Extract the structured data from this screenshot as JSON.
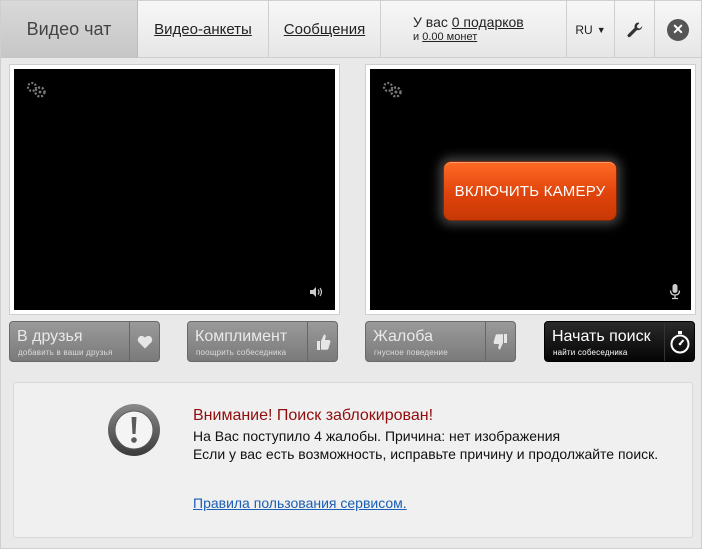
{
  "nav": {
    "active_tab": "Видео чат",
    "tab_profiles": "Видео-анкеты",
    "tab_messages": "Сообщения",
    "gifts_prefix": "У вас",
    "gifts_link": "0 подарков",
    "coins_prefix": "и",
    "coins_link": "0.00 монет",
    "language": "RU",
    "icons": {
      "settings": "wrench-icon",
      "close": "close-icon",
      "lang_caret": "chevron-down-icon"
    }
  },
  "video": {
    "left_icons": [
      "gear-icon",
      "speaker-icon"
    ],
    "right_icons": [
      "gear-icon",
      "microphone-icon"
    ],
    "camera_button": "ВКЛЮЧИТЬ КАМЕРУ"
  },
  "actions": [
    {
      "label": "В друзья",
      "sub": "добавить в ваши друзья",
      "icon": "heart-icon"
    },
    {
      "label": "Комплимент",
      "sub": "поощрить собеседника",
      "icon": "thumbs-up-icon"
    },
    {
      "label": "Жалоба",
      "sub": "гнусное поведение",
      "icon": "thumbs-down-icon"
    },
    {
      "label": "Начать поиск",
      "sub": "найти собеседника",
      "icon": "stopwatch-icon"
    }
  ],
  "notice": {
    "icon": "exclamation-icon",
    "title": "Внимание! Поиск заблокирован!",
    "line1": "На Вас поступило 4 жалобы. Причина: нет изображения",
    "line2": "Если у вас есть возможность, исправьте причину и продолжайте поиск.",
    "rules_link": "Правила пользования сервисом."
  },
  "colors": {
    "camera_button": "#e0430b",
    "notice_title": "#8f0d0d",
    "link": "#1a5fb4"
  }
}
